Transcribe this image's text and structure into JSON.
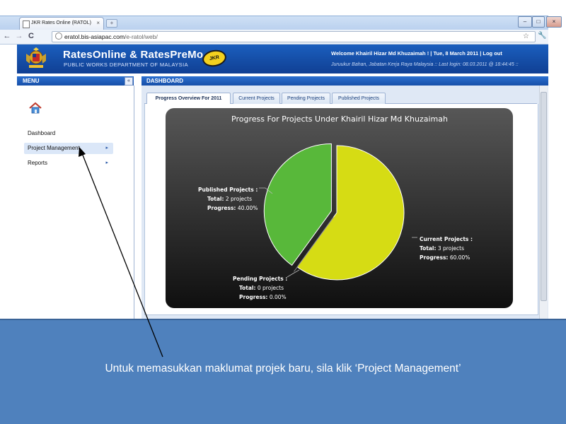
{
  "browser": {
    "tab_title": "JKR Rates Online (RATOL)",
    "tab_close": "×",
    "new_tab": "+",
    "window_controls": [
      "–",
      "□",
      "×"
    ],
    "url_domain": "eratol.bis-asiapac.com",
    "url_path": "/e-ratol/web/",
    "back": "←",
    "forward": "→",
    "reload": "C"
  },
  "header": {
    "brand": "RatesOnline & RatesPreMo",
    "department": "PUBLIC WORKS DEPARTMENT OF MALAYSIA",
    "jkr_logo": "JKR",
    "welcome": "Welcome Khairil Hizar Md Khuzaimah ! | Tue, 8 March 2011 | Log out",
    "last_login": "Juruukur Bahan, Jabatan Kerja Raya Malaysia :: Last login: 08.03.2011 @ 18:44:45 ::"
  },
  "sidebar": {
    "title": "MENU",
    "collapse": "«",
    "items": [
      {
        "label": "Dashboard",
        "arrow": ""
      },
      {
        "label": "Project Management",
        "arrow": "▸"
      },
      {
        "label": "Reports",
        "arrow": "▸"
      }
    ]
  },
  "dashboard": {
    "title": "DASHBOARD",
    "tabs": [
      {
        "label": "Progress Overview For 2011",
        "active": true
      },
      {
        "label": "Current Projects",
        "active": false
      },
      {
        "label": "Pending Projects",
        "active": false
      },
      {
        "label": "Published Projects",
        "active": false
      }
    ]
  },
  "chart_data": {
    "type": "pie",
    "title": "Progress For Projects Under Khairil Hizar Md Khuzaimah",
    "slices": [
      {
        "name": "Current Projects :",
        "total_label": "Total:",
        "total": "3 projects",
        "progress_label": "Progress:",
        "progress": "60.00%",
        "value": 60.0,
        "color": "#d6dc14",
        "exploded": false
      },
      {
        "name": "Pending Projects :",
        "total_label": "Total:",
        "total": "0 projects",
        "progress_label": "Progress:",
        "progress": "0.00%",
        "value": 0.0,
        "color": "#888888",
        "exploded": true
      },
      {
        "name": "Published Projects :",
        "total_label": "Total:",
        "total": "2 projects",
        "progress_label": "Progress:",
        "progress": "40.00%",
        "value": 40.0,
        "color": "#58b83a",
        "exploded": true
      }
    ],
    "background": "#1e1e1e",
    "text_color": "#ffffff",
    "legend": "none"
  },
  "instruction": {
    "text": "Untuk memasukkan maklumat projek baru, sila klik ‘Project Management’",
    "background": "#4f81bd"
  }
}
